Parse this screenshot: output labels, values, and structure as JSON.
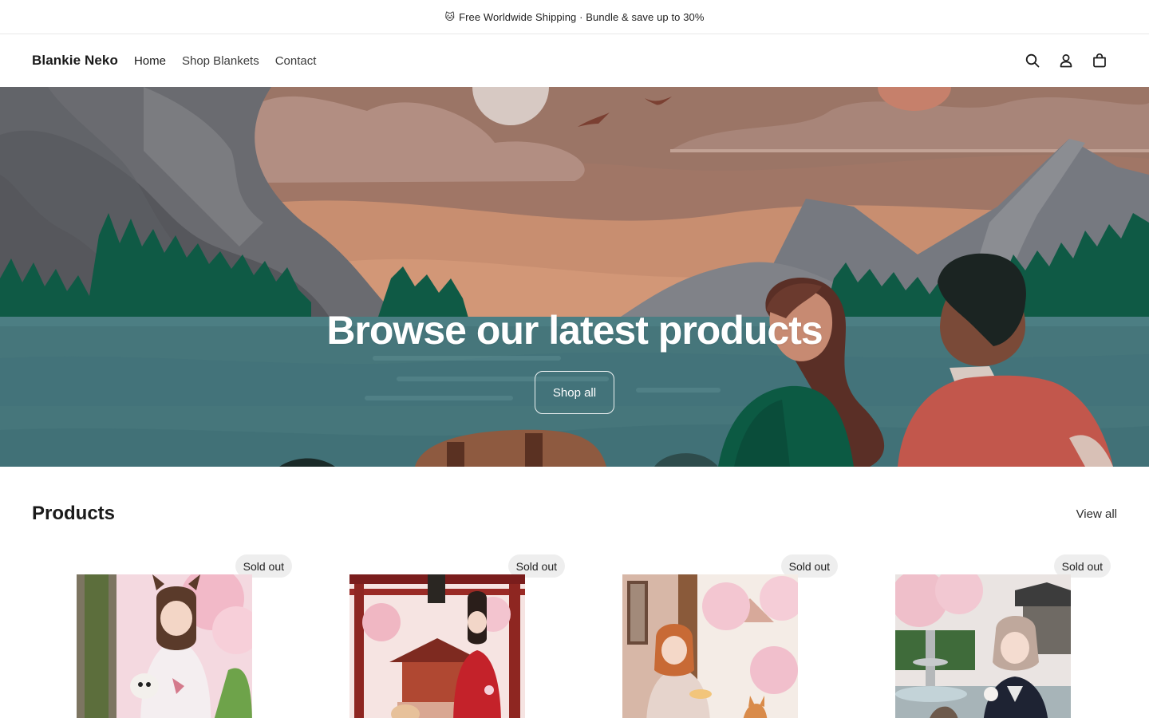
{
  "announcement": {
    "icon": "cat-face-icon",
    "text": "Free Worldwide Shipping · Bundle & save up to 30%"
  },
  "header": {
    "brand": "Blankie Neko",
    "nav": [
      {
        "label": "Home"
      },
      {
        "label": "Shop Blankets"
      },
      {
        "label": "Contact"
      }
    ],
    "icons": [
      "search-icon",
      "account-icon",
      "cart-icon"
    ]
  },
  "hero": {
    "title": "Browse our latest products",
    "button": "Shop all"
  },
  "products": {
    "title": "Products",
    "view_all": "View all",
    "items": [
      {
        "badge": "Sold out"
      },
      {
        "badge": "Sold out"
      },
      {
        "badge": "Sold out"
      },
      {
        "badge": "Sold out"
      }
    ]
  },
  "colors": {
    "sky": "#9a6f5f",
    "water": "#44767a",
    "forest": "#0e5a45",
    "mountain": "#5d6066",
    "badge_bg": "#eeeeee"
  }
}
